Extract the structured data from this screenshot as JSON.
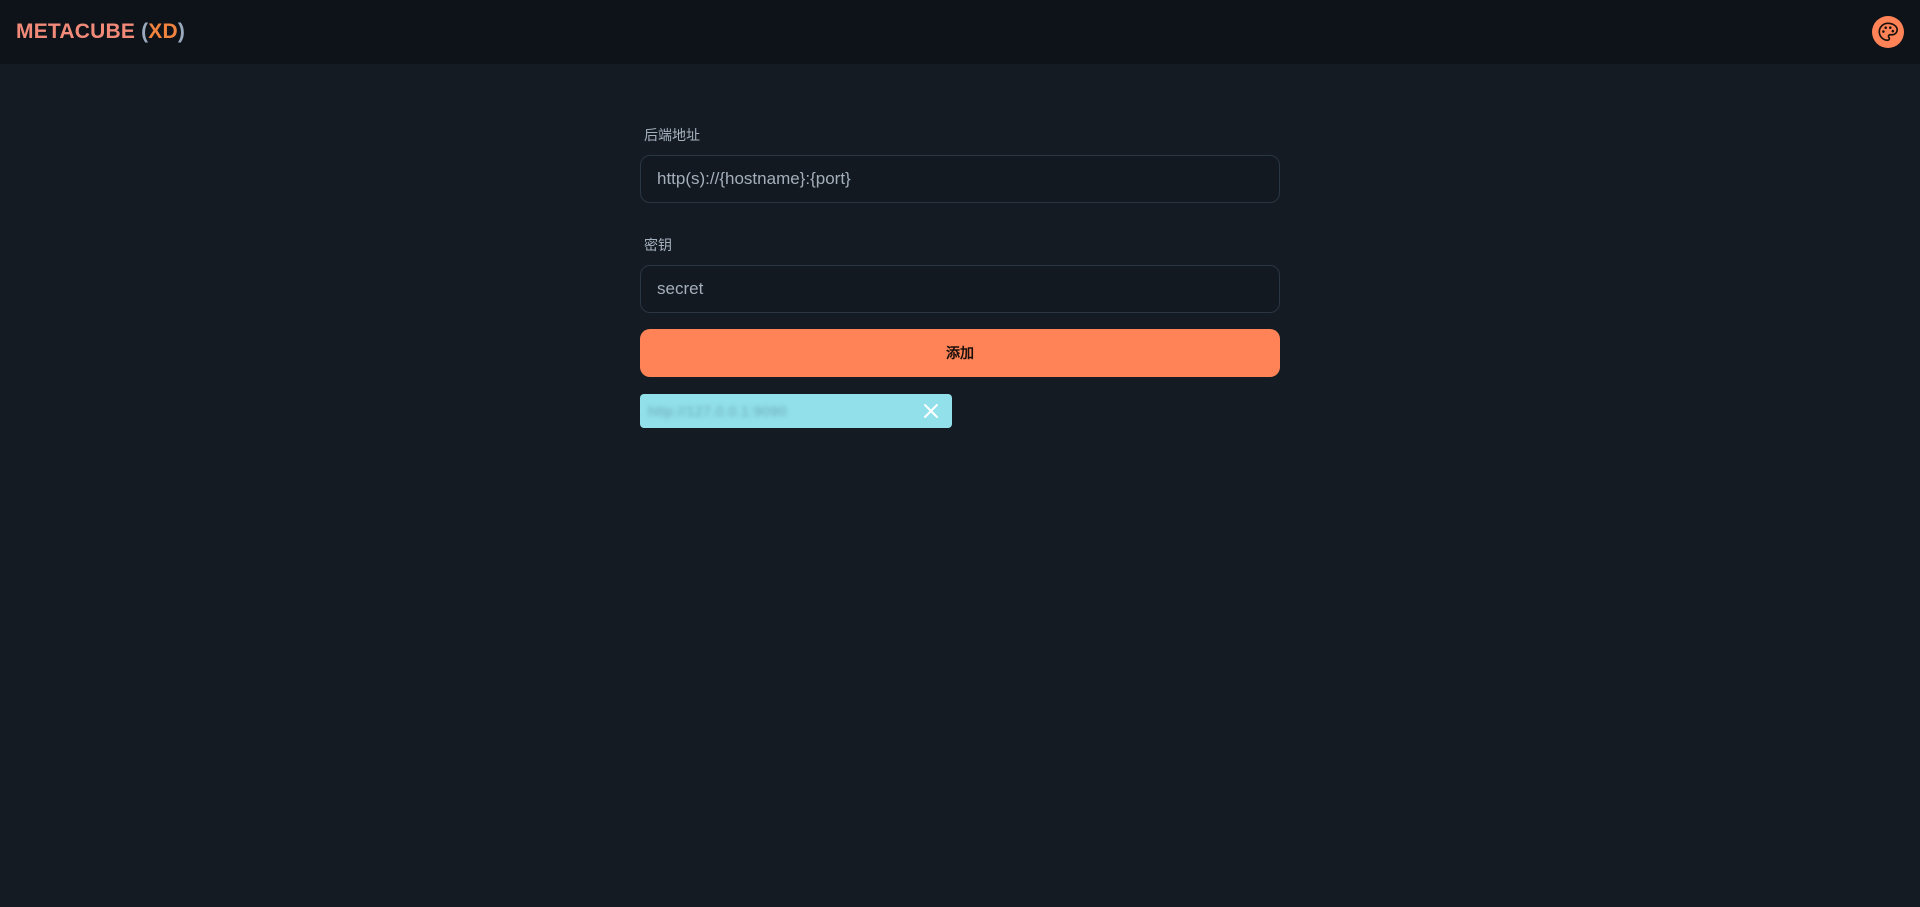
{
  "header": {
    "brand_name": "METACUBE",
    "brand_open": "(",
    "brand_sub": "XD",
    "brand_close": ")",
    "theme_icon": "palette-icon"
  },
  "form": {
    "backend_label": "后端地址",
    "backend_placeholder": "http(s)://{hostname}:{port}",
    "secret_label": "密钥",
    "secret_placeholder": "secret",
    "add_label": "添加"
  },
  "backends": [
    {
      "url": "http://127.0.0.1:9090"
    }
  ],
  "colors": {
    "background": "#141b22",
    "topbar": "#0d1318",
    "accent": "#ff8357",
    "chip": "#91e0ea"
  }
}
